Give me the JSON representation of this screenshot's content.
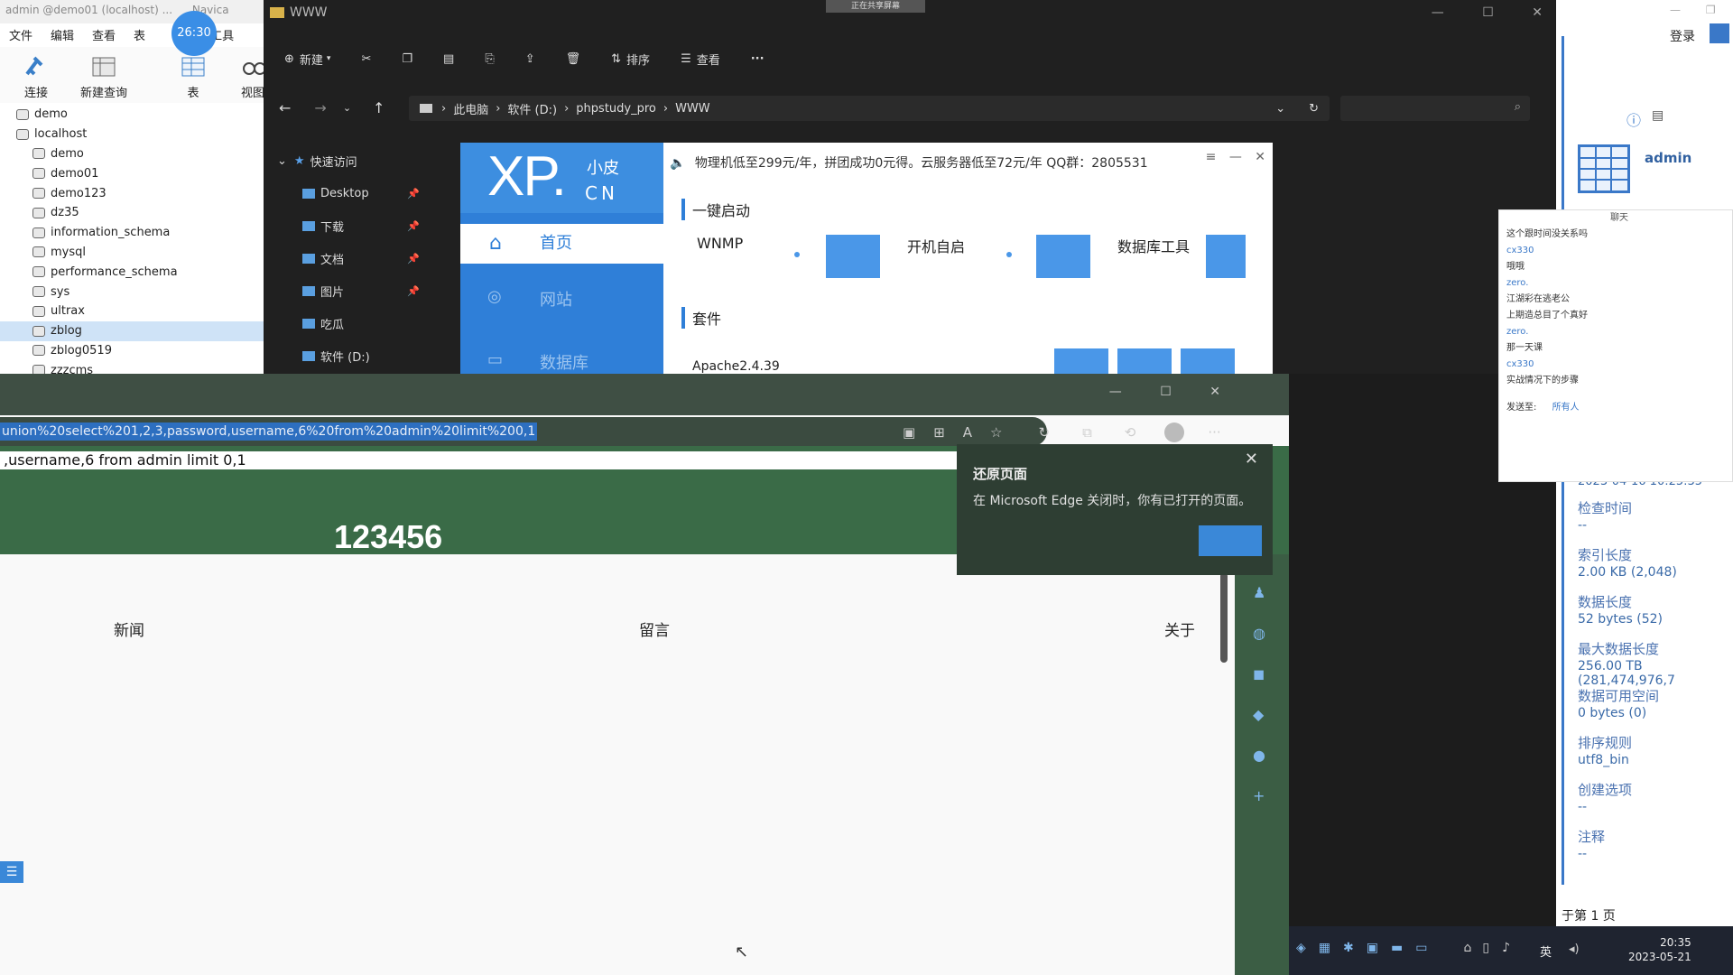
{
  "navicat": {
    "title": "admin @demo01 (localhost) ...",
    "title_right": "Navica",
    "menu": [
      "文件",
      "编辑",
      "查看",
      "表",
      "工具"
    ],
    "tools": {
      "connect": "连接",
      "new_query": "新建查询",
      "table": "表",
      "view": "视图"
    },
    "timer_badge": "26:30",
    "tree": [
      {
        "label": "demo",
        "level": 0,
        "type": "conn"
      },
      {
        "label": "localhost",
        "level": 0,
        "type": "conn"
      },
      {
        "label": "demo",
        "level": 1,
        "type": "db"
      },
      {
        "label": "demo01",
        "level": 1,
        "type": "db"
      },
      {
        "label": "demo123",
        "level": 1,
        "type": "db"
      },
      {
        "label": "dz35",
        "level": 1,
        "type": "db"
      },
      {
        "label": "information_schema",
        "level": 1,
        "type": "db"
      },
      {
        "label": "mysql",
        "level": 1,
        "type": "db"
      },
      {
        "label": "performance_schema",
        "level": 1,
        "type": "db"
      },
      {
        "label": "sys",
        "level": 1,
        "type": "db"
      },
      {
        "label": "ultrax",
        "level": 1,
        "type": "db"
      },
      {
        "label": "zblog",
        "level": 1,
        "type": "db",
        "selected": true
      },
      {
        "label": "zblog0519",
        "level": 1,
        "type": "db"
      },
      {
        "label": "zzzcms",
        "level": 1,
        "type": "db"
      }
    ]
  },
  "explorer": {
    "title": "WWW",
    "toolbar": {
      "new": "新建",
      "sort": "排序",
      "view": "查看",
      "more": "···"
    },
    "status_pill": "正在共享屏幕",
    "breadcrumb": [
      "此电脑",
      "软件 (D:)",
      "phpstudy_pro",
      "WWW"
    ],
    "sidebar": {
      "quick_access": "快速访问",
      "items": [
        {
          "label": "Desktop",
          "pinned": true
        },
        {
          "label": "下载",
          "pinned": true
        },
        {
          "label": "文档",
          "pinned": true
        },
        {
          "label": "图片",
          "pinned": true
        },
        {
          "label": "吃瓜",
          "pinned": false
        },
        {
          "label": "软件 (D:)",
          "pinned": false
        }
      ]
    }
  },
  "phpstudy": {
    "logo_main": "XP.",
    "logo_sub1": "小皮",
    "logo_sub2": "CN",
    "nav": [
      "首页",
      "网站",
      "数据库"
    ],
    "notice": "物理机低至299元/年，拼团成功0元得。云服务器低至72元/年 QQ群：2805531",
    "section_quick": "一键启动",
    "wnmp": "WNMP",
    "autostart": "开机自启",
    "db_tool": "数据库工具",
    "section_suite": "套件",
    "suite_item": "Apache2.4.39"
  },
  "edge": {
    "url": "union%20select%201,2,3,password,username,6%20from%20admin%20limit%200,1",
    "query_line": ",username,6 from admin limit 0,1",
    "result_number": "123456",
    "nav": [
      "新闻",
      "留言",
      "关于"
    ],
    "restore_popup": {
      "title": "还原页面",
      "body": "在 Microsoft Edge 关闭时，你有已打开的页面。"
    }
  },
  "right_panel": {
    "login": "登录",
    "user": "admin",
    "timestamp_partial": "2023-04-16 10:25:35",
    "fields": [
      {
        "label": "检查时间",
        "value": "--"
      },
      {
        "label": "索引长度",
        "value": "2.00 KB (2,048)"
      },
      {
        "label": "数据长度",
        "value": "52 bytes (52)"
      },
      {
        "label": "最大数据长度",
        "value": "256.00 TB (281,474,976,7"
      },
      {
        "label": "数据可用空间",
        "value": "0 bytes (0)"
      },
      {
        "label": "排序规则",
        "value": "utf8_bin"
      },
      {
        "label": "创建选项",
        "value": "--"
      },
      {
        "label": "注释",
        "value": "--"
      }
    ],
    "page": "于第 1 页"
  },
  "chat": {
    "title": "聊天",
    "messages": [
      {
        "text": "这个跟时间没关系吗",
        "type": "msg"
      },
      {
        "text": "cx330",
        "type": "name"
      },
      {
        "text": "哦哦",
        "type": "msg"
      },
      {
        "text": "zero.",
        "type": "name"
      },
      {
        "text": "江湖彩在逃老公",
        "type": "msg"
      },
      {
        "text": "上期造总目了个真好",
        "type": "msg"
      },
      {
        "text": "zero.",
        "type": "name"
      },
      {
        "text": "那一天课",
        "type": "msg"
      },
      {
        "text": "cx330",
        "type": "name"
      },
      {
        "text": "实战情况下的步骤",
        "type": "msg"
      }
    ],
    "send_to_label": "发送至:",
    "send_to_value": "所有人"
  },
  "taskbar": {
    "lang": "英",
    "time": "20:35",
    "date": "2023-05-21"
  },
  "colors": {
    "phpstudy_blue": "#2f7fd8",
    "edge_green": "#3a6b47",
    "explorer_dark": "#202020"
  }
}
